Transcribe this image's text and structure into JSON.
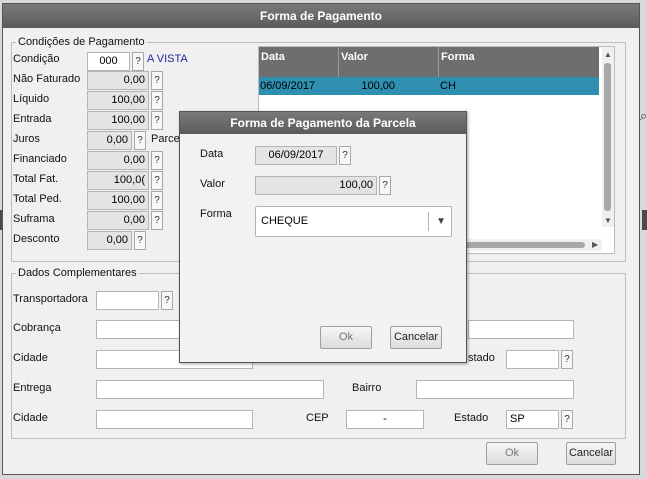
{
  "window": {
    "title": "Forma de Pagamento"
  },
  "condicoes": {
    "legend": "Condições de Pagamento",
    "condicao": {
      "label": "Condição",
      "value": "000",
      "description": "A VISTA"
    },
    "nao_faturado": {
      "label": "Não Faturado",
      "value": "0,00"
    },
    "liquido": {
      "label": "Líquido",
      "value": "100,00"
    },
    "entrada": {
      "label": "Entrada",
      "value": "100,00"
    },
    "juros": {
      "label": "Juros",
      "value": "0,00",
      "extra_label": "Parce"
    },
    "financiado": {
      "label": "Financiado",
      "value": "0,00"
    },
    "total_fat": {
      "label": "Total Fat.",
      "value": "100,0("
    },
    "total_ped": {
      "label": "Total Ped.",
      "value": "100,00"
    },
    "suframa": {
      "label": "Suframa",
      "value": "0,00"
    },
    "desconto": {
      "label": "Desconto",
      "value": "0,00"
    },
    "help_glyph": "?"
  },
  "grid": {
    "columns": [
      "Data",
      "Valor",
      "Forma"
    ],
    "rows": [
      {
        "data": "06/09/2017",
        "valor": "100,00",
        "forma": "CH"
      }
    ]
  },
  "complementares": {
    "legend": "Dados Complementares",
    "transportadora_label": "Transportadora",
    "cobranca_label": "Cobrança",
    "cidade_label": "Cidade",
    "estado_label_partial": "stado",
    "entrega_label": "Entrega",
    "bairro_label": "Bairro",
    "cidade2_label": "Cidade",
    "cep_label": "CEP",
    "cep_value": "-",
    "estado_label": "Estado",
    "estado_value": "SP"
  },
  "buttons": {
    "ok": "Ok",
    "cancel": "Cancelar"
  },
  "dialog": {
    "title": "Forma de Pagamento da Parcela",
    "data_label": "Data",
    "data_value": "06/09/2017",
    "valor_label": "Valor",
    "valor_value": "100,00",
    "forma_label": "Forma",
    "forma_value": "CHEQUE",
    "ok": "Ok",
    "cancel": "Cancelar"
  },
  "colors": {
    "titlebar": "#6a6a6a",
    "selected_row": "#2e8fb0",
    "link_blue": "#1a2c9c"
  }
}
